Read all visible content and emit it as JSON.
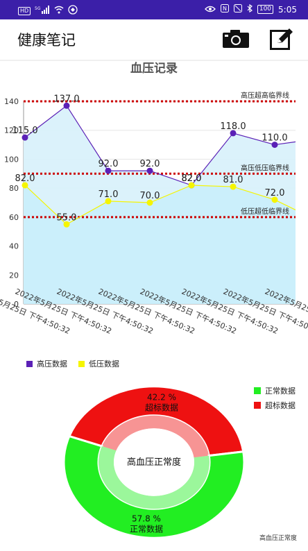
{
  "status_bar": {
    "left_items": [
      "HD",
      "5G",
      "signal",
      "wifi",
      "app-notification"
    ],
    "time": "5:05",
    "battery": "100"
  },
  "app": {
    "title": "健康笔记",
    "camera_icon": "camera-icon",
    "edit_icon": "edit-icon"
  },
  "chart_data": [
    {
      "type": "line",
      "title": "血压记录",
      "categories": [
        "2022年5月25日 下午4:50:32",
        "2022年5月25日 下午4:50:32",
        "2022年5月25日 下午4:50:32",
        "2022年5月25日 下午4:50:32",
        "2022年5月25日 下午4:50:32",
        "2022年5月25日 下午4:50:32",
        "2022年5月25日 下午4:50:32",
        "2022年5月25日 下午4:50:32"
      ],
      "series": [
        {
          "name": "高压数据",
          "values": [
            115.0,
            137.0,
            92.0,
            92.0,
            82.0,
            118.0,
            110.0,
            112.0
          ],
          "color": "#5b21b6"
        },
        {
          "name": "低压数据",
          "values": [
            82.0,
            55.0,
            71.0,
            70.0,
            82.0,
            81.0,
            72.0,
            65.0
          ],
          "color": "#f5f500"
        }
      ],
      "data_labels": [
        "115.0",
        "137.0",
        "92.0",
        "92.0",
        "82.0",
        "118.0",
        "110.0",
        "",
        "82.0",
        "55.0",
        "71.0",
        "70.0",
        "82.0",
        "81.0",
        "72.0",
        ""
      ],
      "reference_lines": [
        {
          "label": "高压超高临界线",
          "value": 140,
          "color": "#cc0000"
        },
        {
          "label": "高压低压临界线",
          "value": 90,
          "color": "#cc0000"
        },
        {
          "label": "低压超低临界线",
          "value": 60,
          "color": "#cc0000"
        }
      ],
      "ylim": [
        0,
        140
      ],
      "yticks": [
        0,
        20,
        40,
        60,
        80,
        100,
        120,
        140
      ],
      "grid": true,
      "legend": "bottom-left"
    },
    {
      "type": "pie",
      "center_label": "高血压正常度",
      "description": "高血压正常度",
      "slices": [
        {
          "name": "正常数据",
          "value": 57.8,
          "percent_label": "57.8 %",
          "color": "#22ee22"
        },
        {
          "name": "超标数据",
          "value": 42.2,
          "percent_label": "42.2 %",
          "color": "#ee1111"
        }
      ],
      "legend": "top-right"
    }
  ]
}
